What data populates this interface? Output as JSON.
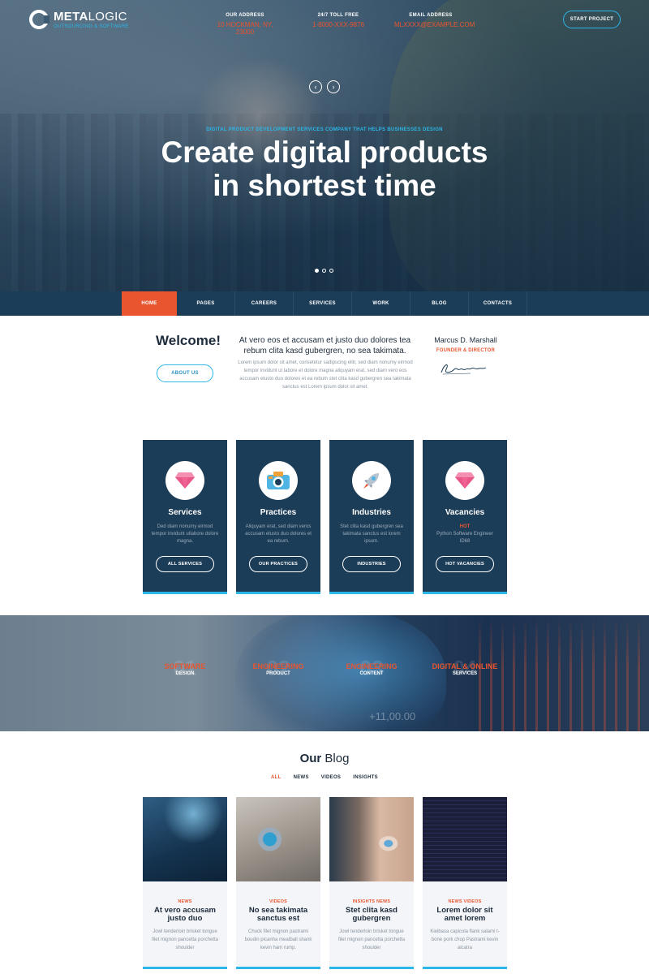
{
  "header": {
    "brand_bold": "META",
    "brand_light": "LOGIC",
    "tagline": "OUTSOURCING & SOFTWARE",
    "contacts": [
      {
        "label": "OUR ADDRESS",
        "value": "10 HOCKMAN, NY, 23000"
      },
      {
        "label": "24/7 TOLL FREE",
        "value": "1-8000-XXX-9876"
      },
      {
        "label": "EMAIL ADDRESS",
        "value": "MLXXXX@EXAMPLE.COM"
      }
    ],
    "start_project": "START PROJECT"
  },
  "hero": {
    "kicker": "DIGITAL PRODUCT DEVELOPMENT SERVICES COMPANY THAT HELPS BUSINESSES DESIGN",
    "headline_line1": "Create digital products",
    "headline_line2": "in shortest time",
    "prev_icon": "‹",
    "next_icon": "›",
    "active_slide": 1
  },
  "nav": {
    "items": [
      "HOME",
      "PAGES",
      "CAREERS",
      "SERVICES",
      "WORK",
      "BLOG",
      "CONTACTS"
    ],
    "active": "HOME"
  },
  "welcome": {
    "title": "Welcome!",
    "about_button": "ABOUT US",
    "lead": "At vero eos et accusam et justo duo dolores tea rebum clita kasd gubergren, no sea takimata.",
    "body": "Lorem ipsum dolor sit amet, consetetur sadipscing elitr, sed diam nonumy eirmod tempor invidunt ut labore et dolore magna aliquyam erat, sed diam vero eos accusam etusto duo dolores et ea rebum stet clita kasd gubergren sea takimata sanctus est Lorem ipsum dolor sit amet.",
    "person_name": "Marcus D. Marshall",
    "person_role": "FOUNDER & DIRECTOR",
    "signature_text": "Signature"
  },
  "cards": [
    {
      "title": "Services",
      "desc": "Ded diam nonumy eirmod tempor invidunt utlabore dolore magna.",
      "hot": "",
      "button": "ALL SERVICES",
      "icon": "diamond-icon"
    },
    {
      "title": "Practices",
      "desc": "Aliquyam erat, sed diam veros accusam etusto duo dolores et ea rebum.",
      "hot": "",
      "button": "OUR PRACTICES",
      "icon": "camera-icon"
    },
    {
      "title": "Industries",
      "desc": "Stet clita kasd gubergren sea takimata sanctus est lorem ipsum.",
      "hot": "",
      "button": "INDUSTRIES",
      "icon": "rocket-icon"
    },
    {
      "title": "Vacancies",
      "desc": "Python Software Engineer ID68",
      "hot": "HOT",
      "button": "HOT VACANCIES",
      "icon": "diamond-icon"
    }
  ],
  "stats": [
    {
      "num": "01",
      "t1": "SOFTWARE",
      "t2": "DESIGN"
    },
    {
      "num": "02",
      "t1": "ENGINEERING",
      "t2": "PRODUCT"
    },
    {
      "num": "03",
      "t1": "ENGINEERING",
      "t2": "CONTENT"
    },
    {
      "num": "04",
      "t1": "DIGITAL & ONLINE",
      "t2": "SERVICES"
    }
  ],
  "band_ticker": "+11,00.00",
  "blog": {
    "title_bold": "Our",
    "title_light": "Blog",
    "filters": [
      "ALL",
      "NEWS",
      "VIDEOS",
      "INSIGHTS"
    ],
    "posts": [
      {
        "category": "NEWS",
        "title": "At vero accusam justo duo",
        "desc": "Jowl tenderloin brisket tongue filet mignon pancetta porchetta shoulder"
      },
      {
        "category": "VIDEOS",
        "title": "No sea takimata sanctus est",
        "desc": "Chuck filet mignon pastrami boudin picanha meatball shank kevin ham rump."
      },
      {
        "category": "INSIGHTS NEWS",
        "title": "Stet clita kasd gubergren",
        "desc": "Jowl tenderloin brisket tongue filet mignon pancetta porchetta shoulder"
      },
      {
        "category": "NEWS VIDEOS",
        "title": "Lorem dolor sit amet lorem",
        "desc": "Kielbasa capicola flank salami t-bone pork chop Pastrami kevin alcatra"
      }
    ]
  },
  "colors": {
    "accent": "#e8552f",
    "brand_blue": "#2bb7e8",
    "navy": "#1c3d58"
  }
}
